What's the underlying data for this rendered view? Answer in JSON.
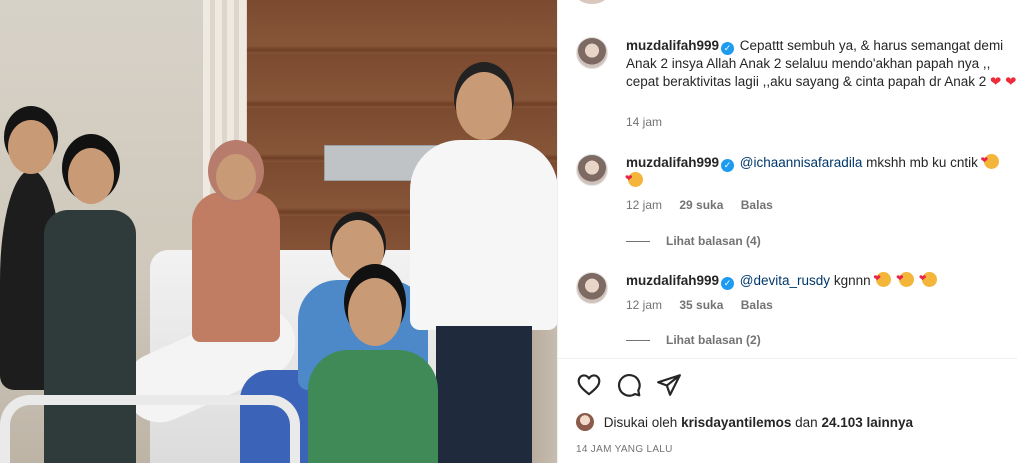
{
  "comments": [
    {
      "username": "muzdalifah999",
      "text": "Cepattt sembuh ya, & harus semangat demi Anak 2 insya Allah Anak 2 selaluu mendo'akhan papah nya ,, cepat beraktivitas lagii ,,aku sayang & cinta papah dr Anak 2",
      "time": "14 jam"
    },
    {
      "username": "muzdalifah999",
      "mention": "@ichaannisafaradila",
      "text": "mkshh mb ku cntik",
      "time": "12 jam",
      "likes": "29 suka",
      "reply": "Balas",
      "view_replies": "Lihat balasan (4)"
    },
    {
      "username": "muzdalifah999",
      "mention": "@devita_rusdy",
      "text": "kgnnn",
      "time": "12 jam",
      "likes": "35 suka",
      "reply": "Balas",
      "view_replies": "Lihat balasan (2)"
    }
  ],
  "actions": {
    "like_icon": "heart-outline-icon",
    "comment_icon": "comment-bubble-icon",
    "share_icon": "paper-plane-icon"
  },
  "liked_by": {
    "prefix": "Disukai oleh",
    "user": "krisdayantilemos",
    "connector": "dan",
    "count": "24.103 lainnya"
  },
  "post_time": "14 JAM YANG LALU",
  "colors": {
    "mention": "#00376b",
    "verified": "#1d9bf0",
    "heart": "#ed2b3a",
    "meta": "#737373"
  }
}
